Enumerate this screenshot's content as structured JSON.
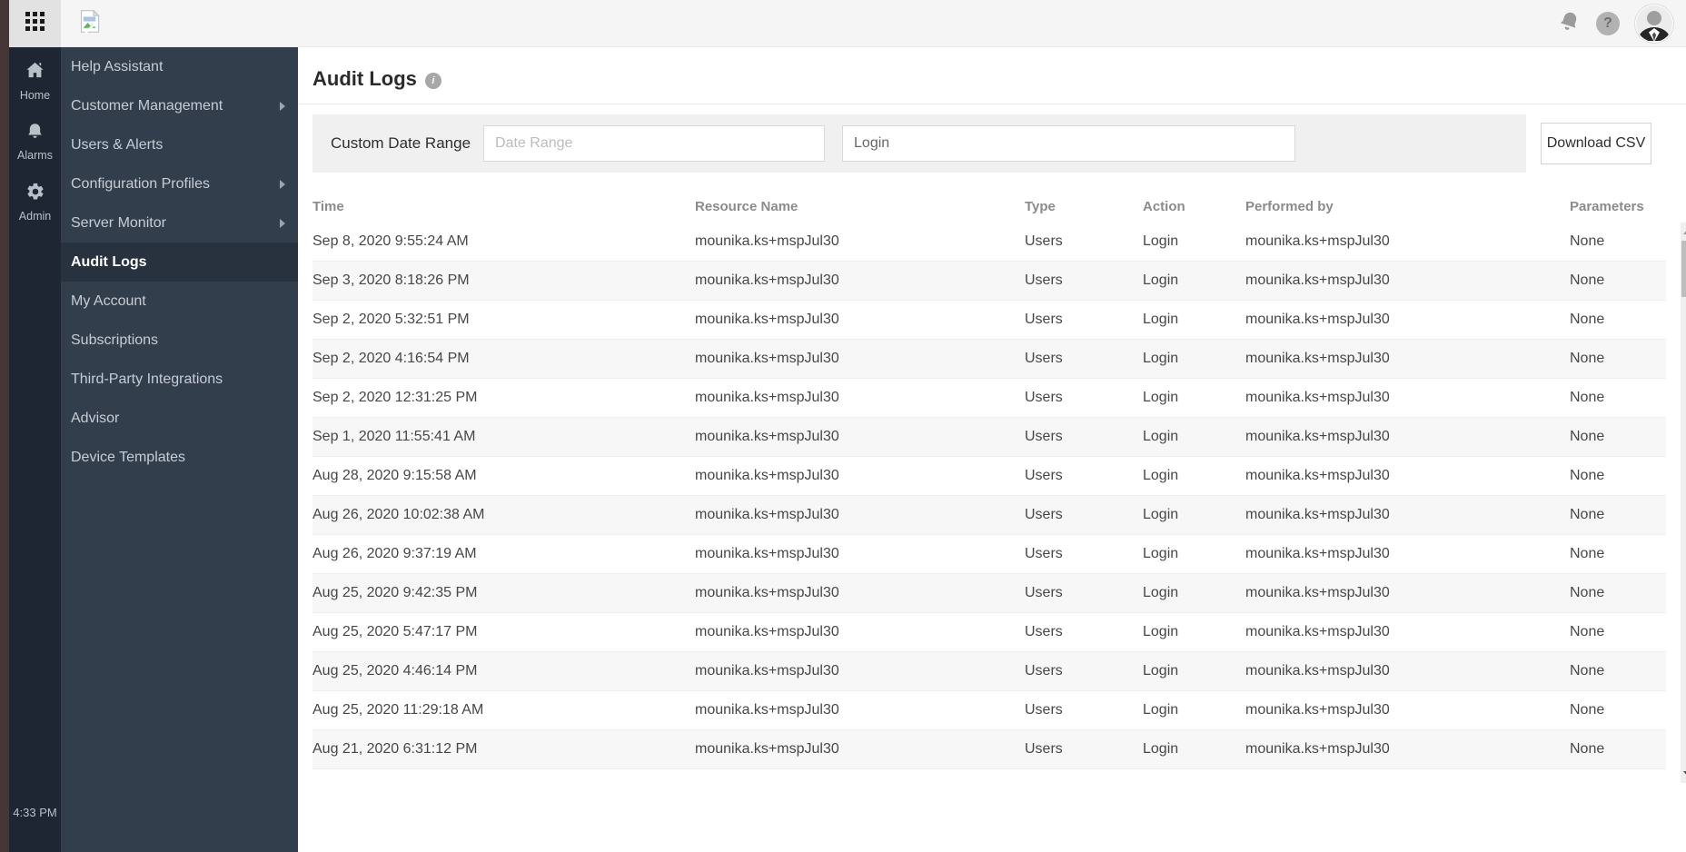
{
  "topbar": {
    "launcher_icon": "grid-icon",
    "logo_icon": "broken-image-icon",
    "notifications_icon": "bell-icon",
    "help_label": "?",
    "avatar_icon": "user-avatar"
  },
  "rail": {
    "items": [
      {
        "label": "Home",
        "icon": "home-icon"
      },
      {
        "label": "Alarms",
        "icon": "alarm-bell-icon"
      },
      {
        "label": "Admin",
        "icon": "gear-icon"
      }
    ],
    "time": "4:33 PM"
  },
  "sidebar": {
    "items": [
      {
        "label": "Help Assistant",
        "has_submenu": false,
        "active": false
      },
      {
        "label": "Customer Management",
        "has_submenu": true,
        "active": false
      },
      {
        "label": "Users & Alerts",
        "has_submenu": false,
        "active": false
      },
      {
        "label": "Configuration Profiles",
        "has_submenu": true,
        "active": false
      },
      {
        "label": "Server Monitor",
        "has_submenu": true,
        "active": false
      },
      {
        "label": "Audit Logs",
        "has_submenu": false,
        "active": true
      },
      {
        "label": "My Account",
        "has_submenu": false,
        "active": false
      },
      {
        "label": "Subscriptions",
        "has_submenu": false,
        "active": false
      },
      {
        "label": "Third-Party Integrations",
        "has_submenu": false,
        "active": false
      },
      {
        "label": "Advisor",
        "has_submenu": false,
        "active": false
      },
      {
        "label": "Device Templates",
        "has_submenu": false,
        "active": false
      }
    ]
  },
  "main": {
    "title": "Audit Logs",
    "filter": {
      "label": "Custom Date Range",
      "date_range_placeholder": "Date Range",
      "audit_function_value": "Login",
      "download_button": "Download CSV"
    },
    "table": {
      "columns": [
        "Time",
        "Resource Name",
        "Type",
        "Action",
        "Performed by",
        "Parameters"
      ],
      "rows": [
        {
          "time": "Sep 8, 2020 9:55:24 AM",
          "resource": "mounika.ks+mspJul30",
          "type": "Users",
          "action": "Login",
          "performed_by": "mounika.ks+mspJul30",
          "parameters": "None"
        },
        {
          "time": "Sep 3, 2020 8:18:26 PM",
          "resource": "mounika.ks+mspJul30",
          "type": "Users",
          "action": "Login",
          "performed_by": "mounika.ks+mspJul30",
          "parameters": "None"
        },
        {
          "time": "Sep 2, 2020 5:32:51 PM",
          "resource": "mounika.ks+mspJul30",
          "type": "Users",
          "action": "Login",
          "performed_by": "mounika.ks+mspJul30",
          "parameters": "None"
        },
        {
          "time": "Sep 2, 2020 4:16:54 PM",
          "resource": "mounika.ks+mspJul30",
          "type": "Users",
          "action": "Login",
          "performed_by": "mounika.ks+mspJul30",
          "parameters": "None"
        },
        {
          "time": "Sep 2, 2020 12:31:25 PM",
          "resource": "mounika.ks+mspJul30",
          "type": "Users",
          "action": "Login",
          "performed_by": "mounika.ks+mspJul30",
          "parameters": "None"
        },
        {
          "time": "Sep 1, 2020 11:55:41 AM",
          "resource": "mounika.ks+mspJul30",
          "type": "Users",
          "action": "Login",
          "performed_by": "mounika.ks+mspJul30",
          "parameters": "None"
        },
        {
          "time": "Aug 28, 2020 9:15:58 AM",
          "resource": "mounika.ks+mspJul30",
          "type": "Users",
          "action": "Login",
          "performed_by": "mounika.ks+mspJul30",
          "parameters": "None"
        },
        {
          "time": "Aug 26, 2020 10:02:38 AM",
          "resource": "mounika.ks+mspJul30",
          "type": "Users",
          "action": "Login",
          "performed_by": "mounika.ks+mspJul30",
          "parameters": "None"
        },
        {
          "time": "Aug 26, 2020 9:37:19 AM",
          "resource": "mounika.ks+mspJul30",
          "type": "Users",
          "action": "Login",
          "performed_by": "mounika.ks+mspJul30",
          "parameters": "None"
        },
        {
          "time": "Aug 25, 2020 9:42:35 PM",
          "resource": "mounika.ks+mspJul30",
          "type": "Users",
          "action": "Login",
          "performed_by": "mounika.ks+mspJul30",
          "parameters": "None"
        },
        {
          "time": "Aug 25, 2020 5:47:17 PM",
          "resource": "mounika.ks+mspJul30",
          "type": "Users",
          "action": "Login",
          "performed_by": "mounika.ks+mspJul30",
          "parameters": "None"
        },
        {
          "time": "Aug 25, 2020 4:46:14 PM",
          "resource": "mounika.ks+mspJul30",
          "type": "Users",
          "action": "Login",
          "performed_by": "mounika.ks+mspJul30",
          "parameters": "None"
        },
        {
          "time": "Aug 25, 2020 11:29:18 AM",
          "resource": "mounika.ks+mspJul30",
          "type": "Users",
          "action": "Login",
          "performed_by": "mounika.ks+mspJul30",
          "parameters": "None"
        },
        {
          "time": "Aug 21, 2020 6:31:12 PM",
          "resource": "mounika.ks+mspJul30",
          "type": "Users",
          "action": "Login",
          "performed_by": "mounika.ks+mspJul30",
          "parameters": "None"
        }
      ]
    }
  },
  "colors": {
    "left_strip": "#473636",
    "rail_bg": "#1d2632",
    "sidebar_bg": "#333e4d",
    "sidebar_active_bg": "#28323f",
    "topbar_bg": "#f5f5f5",
    "filter_panel_bg": "#f0f0f0",
    "row_alt_bg": "#f7f7f7",
    "header_text": "#8b8b8b"
  }
}
